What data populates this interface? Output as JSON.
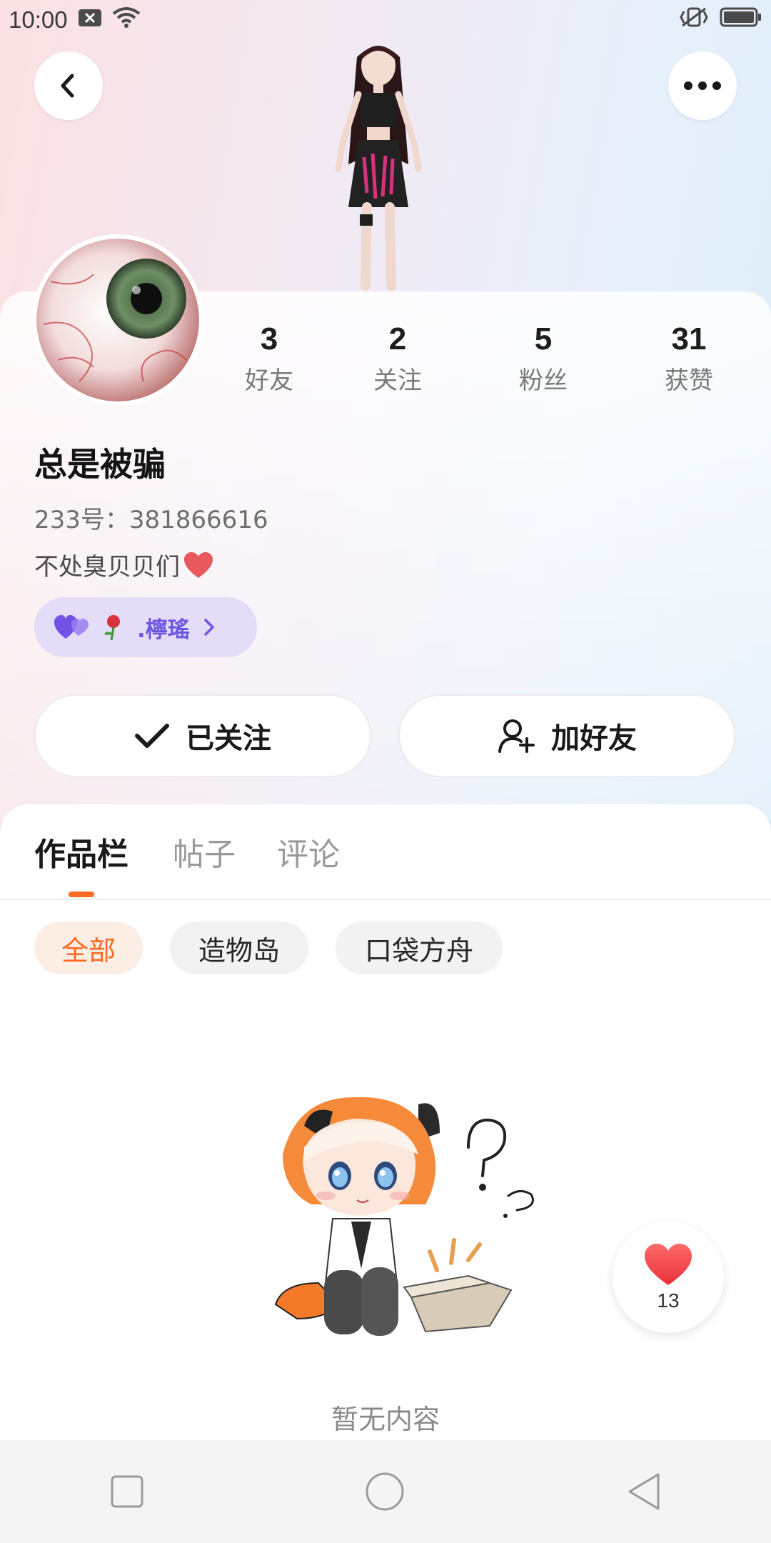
{
  "status_bar": {
    "time": "10:00"
  },
  "profile": {
    "nickname": "总是被骗",
    "uid": "233号：381866616",
    "bio": "不处臭贝贝们",
    "relation_name": ".檸瑤"
  },
  "stats": [
    {
      "value": "3",
      "label": "好友"
    },
    {
      "value": "2",
      "label": "关注"
    },
    {
      "value": "5",
      "label": "粉丝"
    },
    {
      "value": "31",
      "label": "获赞"
    }
  ],
  "actions": {
    "follow_label": "已关注",
    "add_friend_label": "加好友"
  },
  "tabs": [
    {
      "label": "作品栏",
      "active": true
    },
    {
      "label": "帖子"
    },
    {
      "label": "评论"
    }
  ],
  "filters": [
    {
      "label": "全部",
      "active": true
    },
    {
      "label": "造物岛"
    },
    {
      "label": "口袋方舟"
    }
  ],
  "empty_state": {
    "text": "暂无内容"
  },
  "like_button": {
    "count": "13"
  },
  "colors": {
    "accent": "#ff6a22",
    "relation_text": "#6c55e0",
    "heart": "#f0484d"
  }
}
